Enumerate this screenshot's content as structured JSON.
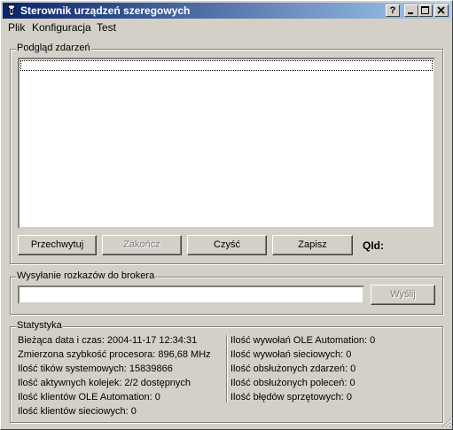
{
  "window": {
    "title": "Sterownik urządzeń szeregowych",
    "help_button": "?"
  },
  "menu": [
    {
      "label": "Plik"
    },
    {
      "label": "Konfiguracja"
    },
    {
      "label": "Test"
    }
  ],
  "events": {
    "group_label": "Podgląd zdarzeń",
    "buttons": {
      "intercept": "Przechwytuj",
      "finish": "Zakończ",
      "clear": "Czyść",
      "save": "Zapisz"
    },
    "qid_label": "QId:"
  },
  "broker": {
    "group_label": "Wysyłanie rozkazów do brokera",
    "input_value": "",
    "send_button": "Wyślij"
  },
  "stats": {
    "group_label": "Statystyka",
    "left": [
      "Bieżąca data i czas: 2004-11-17 12:34:31",
      "Zmierzona szybkość procesora: 896,68 MHz",
      "Ilość tików systemowych: 15839866",
      "Ilość aktywnych kolejek: 2/2 dostępnych",
      "Ilość klientów OLE Automation: 0",
      "Ilość klientów sieciowych: 0"
    ],
    "right": [
      "Ilość wywołań OLE Automation: 0",
      "Ilość wywołań sieciowych: 0",
      "Ilość obsłużonych zdarzeń: 0",
      "Ilość obsłużonych poleceń: 0",
      "Ilość błędów sprzętowych: 0"
    ]
  }
}
